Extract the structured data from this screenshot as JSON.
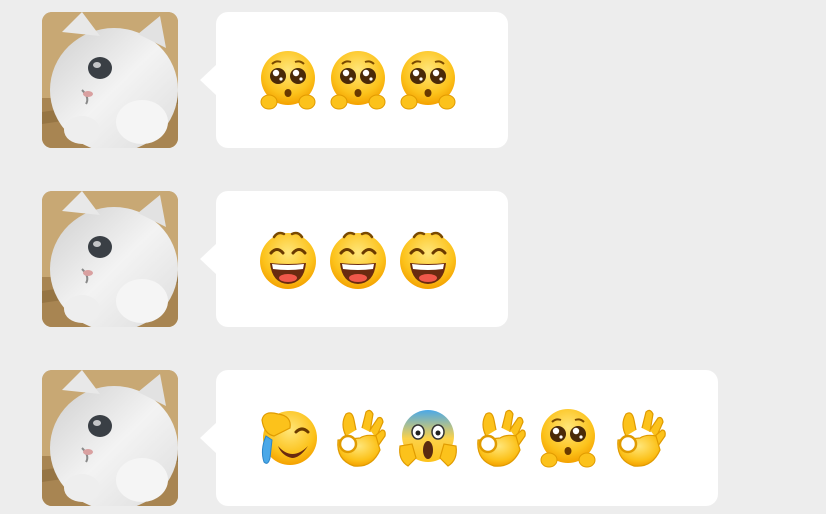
{
  "messages": [
    {
      "emojis": [
        "pleading-face-icon",
        "pleading-face-icon",
        "pleading-face-icon"
      ]
    },
    {
      "emojis": [
        "grinning-face-icon",
        "grinning-face-icon",
        "grinning-face-icon"
      ]
    },
    {
      "emojis": [
        "face-palm-laugh-icon",
        "ok-hand-icon",
        "screaming-face-icon",
        "ok-hand-icon",
        "pleading-face-icon",
        "ok-hand-icon"
      ]
    }
  ],
  "colors": {
    "background": "#ededed",
    "bubble": "#ffffff",
    "emoji_yellow": "#fcc21b"
  }
}
